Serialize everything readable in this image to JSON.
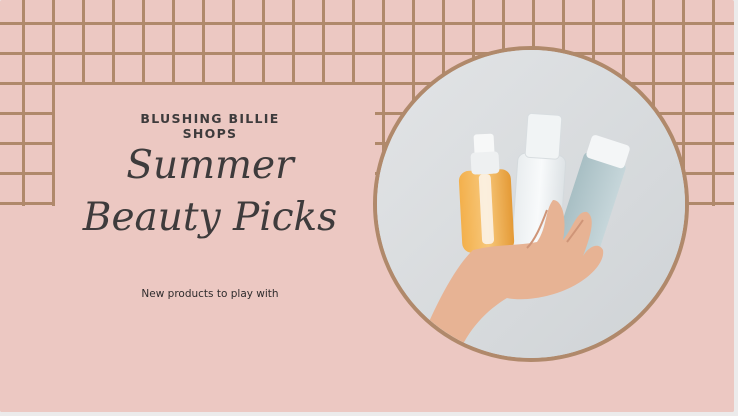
{
  "banner": {
    "brand": "BLUSHING BILLIE SHOPS",
    "title_line1": "Summer",
    "title_line2": "Beauty Picks",
    "subtitle": "New products to play with"
  },
  "colors": {
    "background": "#ecc8c2",
    "grid_lines": "#b0896b",
    "circle_border": "#b0896b",
    "text": "#3e3b3c"
  }
}
